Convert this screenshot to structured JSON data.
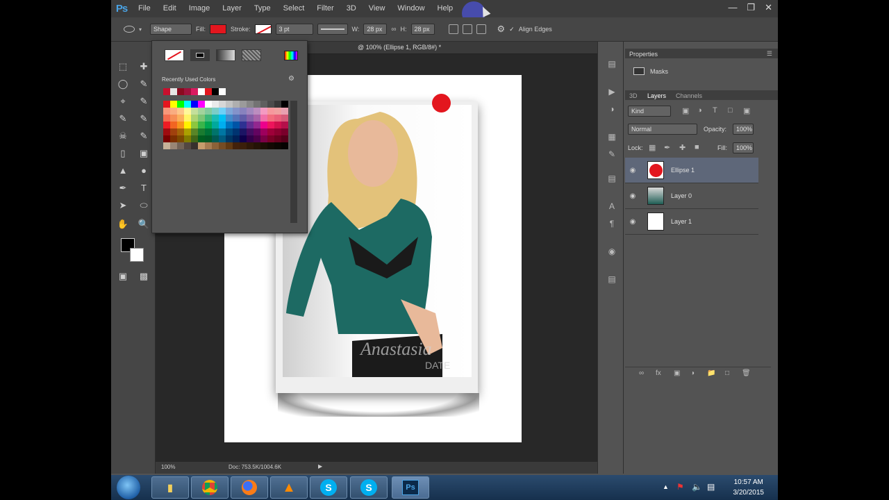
{
  "app": {
    "logo": "Ps"
  },
  "menu": [
    "File",
    "Edit",
    "Image",
    "Layer",
    "Type",
    "Select",
    "Filter",
    "3D",
    "View",
    "Window",
    "Help"
  ],
  "options": {
    "mode": "Shape",
    "fill_label": "Fill:",
    "stroke_label": "Stroke:",
    "stroke_width": "3 pt",
    "w_label": "W:",
    "w_value": "28 px",
    "h_label": "H:",
    "h_value": "28 px",
    "align_edges": "Align Edges"
  },
  "document": {
    "tab_title": "@ 100% (Ellipse 1, RGB/8#) *",
    "zoom": "100%",
    "doc_size": "Doc: 753.5K/1004.6K",
    "watermark_brand": "Anastasia",
    "watermark_sub": "DATE"
  },
  "color_picker": {
    "recent_label": "Recently Used Colors",
    "recent": [
      "#c8102e",
      "#e6e6e6",
      "#8b0a1f",
      "#a0123c",
      "#d81b60",
      "#ffffff",
      "#e3161e",
      "#000000",
      "#ffffff"
    ],
    "palette_rows": [
      [
        "#e3161e",
        "#ffff00",
        "#00ff00",
        "#00ffff",
        "#0000ff",
        "#ff00ff",
        "#ffffff",
        "#ebebeb",
        "#d7d7d7",
        "#c3c3c3",
        "#afafaf",
        "#9b9b9b",
        "#878787",
        "#737373",
        "#5f5f5f",
        "#4b4b4b",
        "#373737",
        "#000000"
      ],
      [
        "#f7977a",
        "#f9ad81",
        "#fdc68a",
        "#fff79a",
        "#c4df9b",
        "#a2d39c",
        "#82ca9d",
        "#7bcdc8",
        "#6ecff6",
        "#7ea7d8",
        "#8493ca",
        "#8882be",
        "#a187be",
        "#bc8dbf",
        "#f49ac2",
        "#f6989d",
        "#f0a0a0",
        "#e8a0b0"
      ],
      [
        "#f26c4f",
        "#f68e55",
        "#fbaf5c",
        "#fff467",
        "#acd372",
        "#7cc576",
        "#3bb878",
        "#1abbb4",
        "#00bff3",
        "#438ccb",
        "#5574b9",
        "#605ca8",
        "#855fa8",
        "#a763a8",
        "#f06ea9",
        "#f26d7d",
        "#e9607a",
        "#d65a78"
      ],
      [
        "#ed1c24",
        "#f26522",
        "#f7941d",
        "#fff200",
        "#8dc63f",
        "#39b54a",
        "#00a651",
        "#00a99d",
        "#00aeef",
        "#0072bc",
        "#0054a6",
        "#2e3192",
        "#662d91",
        "#92278f",
        "#ec008c",
        "#ed145b",
        "#d0104c",
        "#b5104a"
      ],
      [
        "#9e0b0f",
        "#a0410d",
        "#a36209",
        "#aba000",
        "#598527",
        "#1a7b30",
        "#007236",
        "#00746b",
        "#0076a3",
        "#004b80",
        "#003471",
        "#1b1464",
        "#440e62",
        "#630460",
        "#9e005d",
        "#9e0039",
        "#8c0030",
        "#7a002b"
      ],
      [
        "#790000",
        "#7b2e00",
        "#7d4900",
        "#827b00",
        "#406618",
        "#005e20",
        "#005826",
        "#005952",
        "#005b7f",
        "#003663",
        "#002157",
        "#0d004c",
        "#32004b",
        "#4b0049",
        "#7b0046",
        "#7a0026",
        "#68001f",
        "#56001a"
      ],
      [
        "#c7b299",
        "#998675",
        "#736357",
        "#534741",
        "#37302d",
        "#c69c6d",
        "#a67c52",
        "#8c6239",
        "#754c24",
        "#603913",
        "#42210b",
        "#3b1f0a",
        "#2e1808",
        "#241306",
        "#1b0e04",
        "#120903",
        "#0b0602",
        "#050301"
      ]
    ]
  },
  "properties": {
    "title": "Properties",
    "masks": "Masks"
  },
  "layers_panel": {
    "tabs": [
      "3D",
      "Layers",
      "Channels"
    ],
    "kind": "Kind",
    "blend": "Normal",
    "opacity_label": "Opacity:",
    "opacity": "100%",
    "lock_label": "Lock:",
    "fill_label": "Fill:",
    "fill": "100%",
    "layers": [
      {
        "name": "Ellipse 1"
      },
      {
        "name": "Layer 0"
      },
      {
        "name": "Layer 1"
      }
    ]
  },
  "taskbar": {
    "time": "10:57 AM",
    "date": "3/20/2015",
    "apps": [
      "start",
      "explorer",
      "chrome",
      "firefox",
      "vlc",
      "skype",
      "skype",
      "photoshop"
    ]
  },
  "colors": {
    "accent_red": "#e3161e",
    "ps_blue": "#4aa3e4"
  }
}
